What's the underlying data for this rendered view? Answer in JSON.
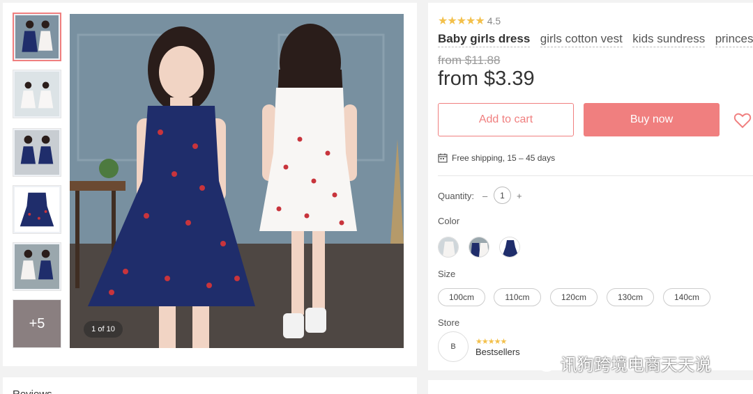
{
  "gallery": {
    "counter": "1 of 10",
    "more_label": "+5"
  },
  "product": {
    "rating_stars": "★★★★★",
    "rating_value": "4.5",
    "tags": [
      "Baby girls dress",
      "girls cotton vest",
      "kids sundress",
      "princess"
    ],
    "old_price": "from $11.88",
    "price": "from $3.39"
  },
  "actions": {
    "add_to_cart": "Add to cart",
    "buy_now": "Buy now"
  },
  "shipping": {
    "text": "Free shipping, 15 – 45 days"
  },
  "quantity": {
    "label": "Quantity:",
    "minus": "–",
    "value": "1",
    "plus": "+"
  },
  "color": {
    "label": "Color"
  },
  "size": {
    "label": "Size",
    "options": [
      "100cm",
      "110cm",
      "120cm",
      "130cm",
      "140cm"
    ]
  },
  "store": {
    "label": "Store",
    "logo_letter": "B",
    "stars": "★★★★★",
    "name": "Bestsellers"
  },
  "reviews": {
    "heading": "Reviews"
  },
  "watermark": {
    "text": "讯狗跨境电商天天说"
  },
  "colors": {
    "accent": "#f07f7f",
    "star": "#f3c04b",
    "navy_dress": "#1f2d6b"
  },
  "icons": [
    "heart-icon",
    "calendar-icon",
    "wechat-icon"
  ]
}
